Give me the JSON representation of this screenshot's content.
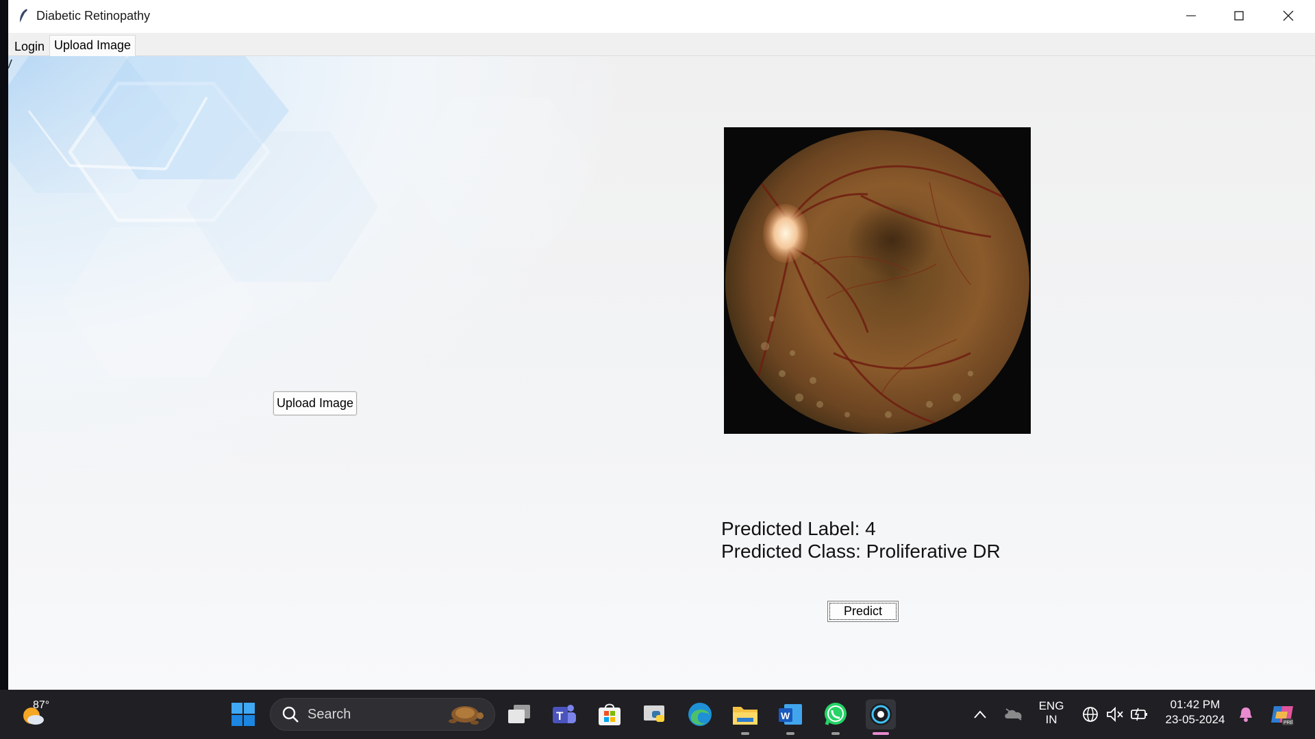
{
  "window": {
    "title": "Diabetic Retinopathy",
    "edge_char": "V"
  },
  "tabs": [
    {
      "label": "Login"
    },
    {
      "label": "Upload Image"
    }
  ],
  "main": {
    "upload_button_label": "Upload Image",
    "predicted_label_text": "Predicted Label: 4",
    "predicted_class_text": "Predicted Class: Proliferative DR",
    "predict_button_label": "Predict",
    "image_icon": "retina-fundus-image"
  },
  "taskbar": {
    "weather_temp": "87°",
    "search_placeholder": "Search",
    "language_line1": "ENG",
    "language_line2": "IN",
    "time": "01:42 PM",
    "date": "23-05-2024",
    "pinned_apps": [
      "start",
      "search",
      "task-view",
      "teams",
      "microsoft-store",
      "python",
      "edge",
      "file-explorer",
      "word",
      "whatsapp",
      "active-app"
    ]
  },
  "colors": {
    "accent_indicator": "#e98bd0",
    "taskbar_bg": "#1f1f24",
    "window_bg": "#f0f0f0"
  }
}
